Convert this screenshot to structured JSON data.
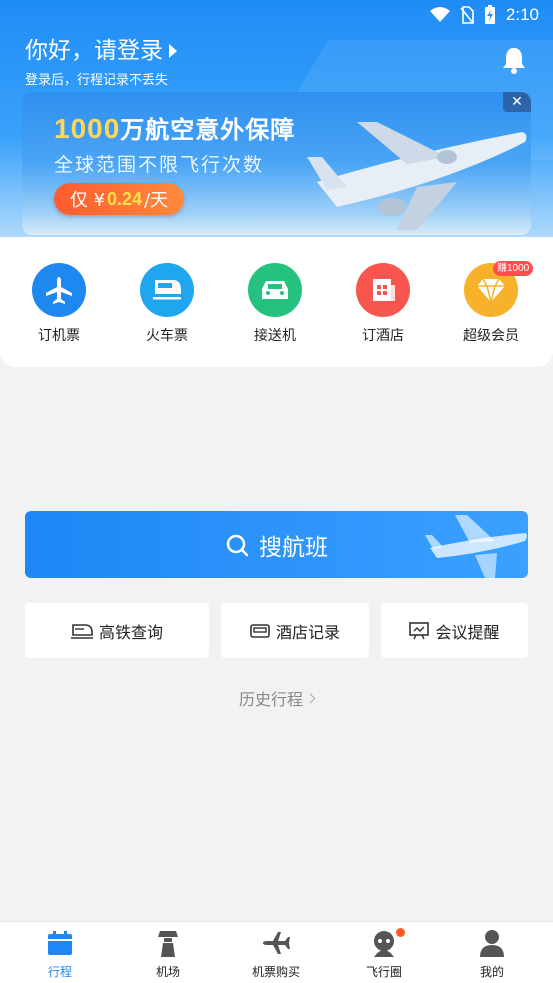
{
  "status": {
    "time": "2:10"
  },
  "header": {
    "greeting": "你好，请登录",
    "subtitle": "登录后，行程记录不丢失"
  },
  "banner": {
    "title_num": "1000",
    "title_rest": "万航空意外保障",
    "subtitle": "全球范围不限飞行次数",
    "cta_prefix": "仅 ¥",
    "cta_price": "0.24",
    "cta_suffix": "/天",
    "close_label": "✕"
  },
  "services": [
    {
      "label": "订机票",
      "icon": "plane-icon",
      "color": "#1e88f0"
    },
    {
      "label": "火车票",
      "icon": "train-icon",
      "color": "#20a6ee"
    },
    {
      "label": "接送机",
      "icon": "car-icon",
      "color": "#25c17f"
    },
    {
      "label": "订酒店",
      "icon": "hotel-icon",
      "color": "#f7564e"
    },
    {
      "label": "超级会员",
      "icon": "diamond-icon",
      "color": "#f8b12a"
    }
  ],
  "vip_badge": "赚1000",
  "search": {
    "label": "搜航班"
  },
  "quick_actions": [
    {
      "label": "高铁查询",
      "icon": "high-speed-rail-icon"
    },
    {
      "label": "酒店记录",
      "icon": "bed-icon"
    },
    {
      "label": "会议提醒",
      "icon": "meeting-icon"
    }
  ],
  "history": {
    "label": "历史行程"
  },
  "tabs": [
    {
      "label": "行程",
      "icon": "calendar-icon",
      "active": true
    },
    {
      "label": "机场",
      "icon": "control-tower-icon",
      "active": false
    },
    {
      "label": "机票购买",
      "icon": "plane-icon",
      "active": false
    },
    {
      "label": "飞行圈",
      "icon": "community-icon",
      "active": false
    },
    {
      "label": "我的",
      "icon": "user-icon",
      "active": false
    }
  ],
  "colors": {
    "primary": "#1e86f5",
    "accent": "#ff5a1f"
  }
}
